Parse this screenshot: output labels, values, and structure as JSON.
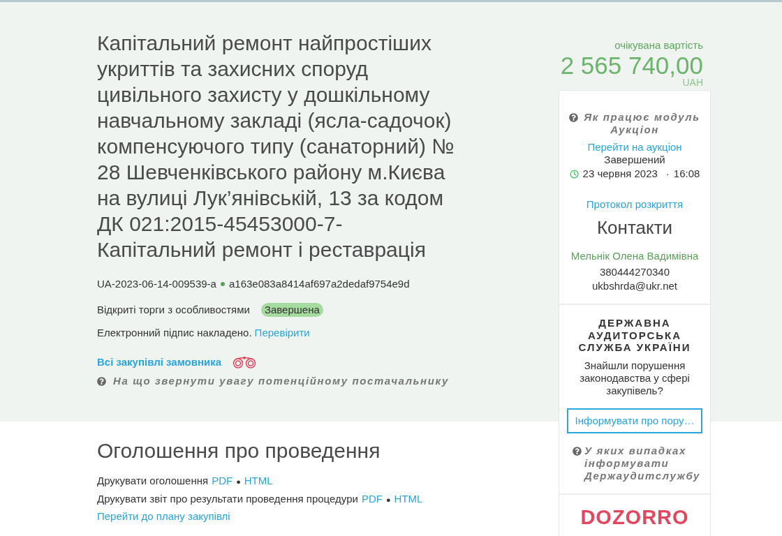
{
  "tender": {
    "title": "Капітальний ремонт найпростіших укриттів та захисних споруд цивільного захисту у дошкільному навчальному закладі (ясла-садочок) компенсуючого типу (санаторний) № 28 Шевченківського району м.Києва на вулиці Лук’янівській, 13 за кодом ДК 021:2015-45453000-7-Капітальний ремонт і реставрація",
    "id": "UA-2023-06-14-009539-a",
    "hash": "a163e083a8414af697a2dedaf9754e9d",
    "procedure_type": "Відкриті торги з особливостями",
    "status": "Завершена",
    "signature": {
      "text": "Електронний підпис накладено.",
      "link": "Перевірити"
    },
    "buyer_link": "Всі закупівлі замовника",
    "help_link": "На що звернути увагу потенційному постачальнику"
  },
  "price": {
    "caption": "очікувана вартість",
    "amount": "2 565 740,00",
    "currency": "UAH"
  },
  "auction": {
    "help_link": "Як працює модуль Аукціон",
    "link": "Перейти на аукціон",
    "status": "Завершений",
    "date": "23 червня 2023",
    "separator": "·",
    "time": "16:08",
    "protocol_link": "Протокол розкриття"
  },
  "contacts": {
    "heading": "Контакти",
    "name": "Мельнік Олена Вадимівна",
    "phone": "380444270340",
    "email": "ukbshrda@ukr.net"
  },
  "audit": {
    "title": "ДЕРЖАВНА АУДИТОРСЬКА СЛУЖБА УКРАЇНИ",
    "question": "Знайшли порушення законодавства у сфері закупівель?",
    "button": "Інформувати про пору…",
    "help_link": "У яких випадках інформувати Держаудитслужбу"
  },
  "partner": {
    "logo": "DOZORRO"
  },
  "announcement": {
    "heading": "Оголошення про проведення",
    "print_lines": [
      {
        "label": "Друкувати оголошення",
        "links": [
          "PDF",
          "HTML"
        ],
        "separator": "●"
      },
      {
        "label": "Друкувати звіт про результати проведення процедури",
        "links": [
          "PDF",
          "HTML"
        ],
        "separator": "●"
      }
    ],
    "plan_link": "Перейти до плану закупівлі"
  }
}
